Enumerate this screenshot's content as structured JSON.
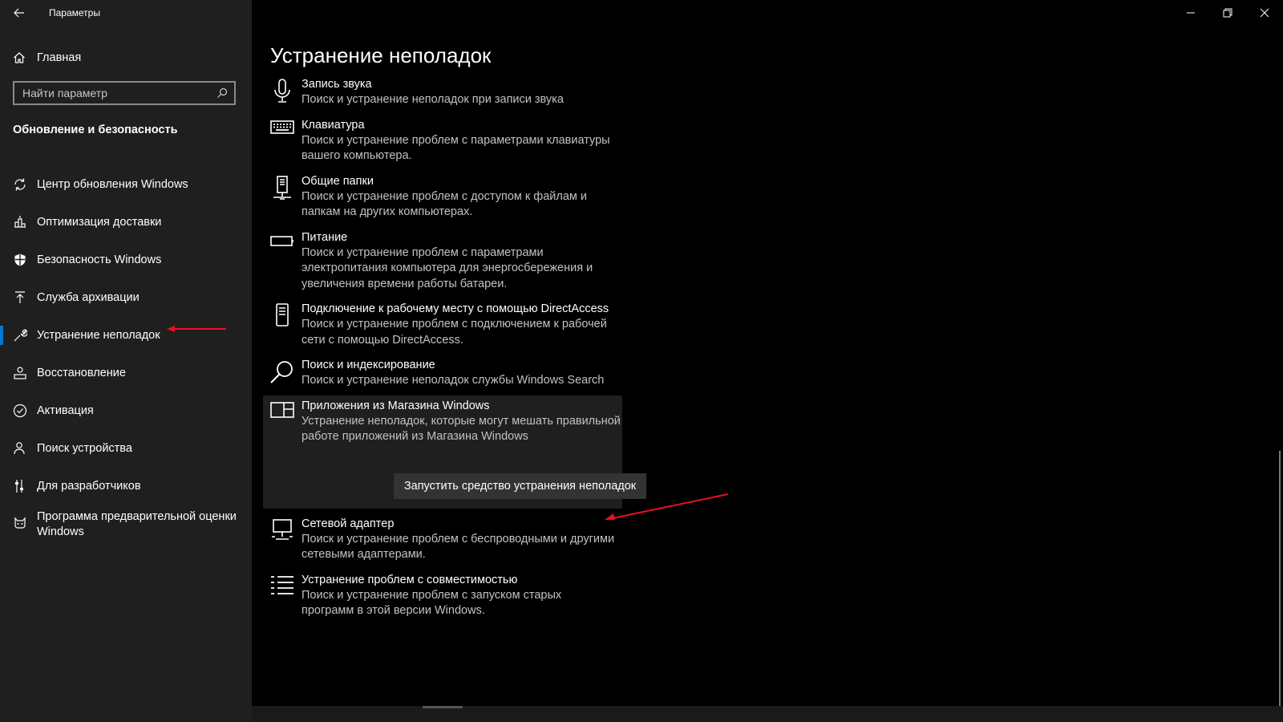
{
  "window": {
    "title": "Параметры"
  },
  "sidebar": {
    "home_label": "Главная",
    "search_placeholder": "Найти параметр",
    "section_title": "Обновление и безопасность",
    "items": [
      {
        "label": "Центр обновления Windows",
        "icon": "refresh-icon"
      },
      {
        "label": "Оптимизация доставки",
        "icon": "delivery-icon"
      },
      {
        "label": "Безопасность Windows",
        "icon": "shield-icon"
      },
      {
        "label": "Служба архивации",
        "icon": "backup-arrow-icon"
      },
      {
        "label": "Устранение неполадок",
        "icon": "wrench-icon",
        "active": true
      },
      {
        "label": "Восстановление",
        "icon": "recovery-icon"
      },
      {
        "label": "Активация",
        "icon": "check-circle-icon"
      },
      {
        "label": "Поиск устройства",
        "icon": "person-location-icon"
      },
      {
        "label": "Для разработчиков",
        "icon": "developer-sliders-icon"
      },
      {
        "label": "Программа предварительной оценки Windows",
        "icon": "insider-cat-icon"
      }
    ]
  },
  "main": {
    "title": "Устранение неполадок",
    "troubleshooters": [
      {
        "name": "Запись звука",
        "desc": "Поиск и устранение неполадок при записи звука",
        "icon": "microphone-icon"
      },
      {
        "name": "Клавиатура",
        "desc": "Поиск и устранение проблем с параметрами клавиатуры вашего компьютера.",
        "icon": "keyboard-icon"
      },
      {
        "name": "Общие папки",
        "desc": "Поиск и устранение проблем с доступом к файлам и папкам на других компьютерах.",
        "icon": "network-folder-icon"
      },
      {
        "name": "Питание",
        "desc": "Поиск и устранение проблем с параметрами электропитания компьютера для энергосбережения и увеличения  времени работы батареи.",
        "icon": "battery-icon"
      },
      {
        "name": "Подключение к рабочему месту с помощью DirectAccess",
        "desc": "Поиск и устранение проблем с подключением к рабочей сети с помощью DirectAccess.",
        "icon": "phone-device-icon"
      },
      {
        "name": "Поиск и индексирование",
        "desc": "Поиск и устранение неполадок службы Windows Search",
        "icon": "search-icon"
      },
      {
        "name": "Приложения из Магазина Windows",
        "desc": "Устранение неполадок, которые могут мешать правильной работе приложений из Магазина Windows",
        "icon": "store-apps-icon",
        "expanded": true
      },
      {
        "name": "Сетевой адаптер",
        "desc": "Поиск и устранение проблем с беспроводными и другими сетевыми адаптерами.",
        "icon": "network-adapter-icon"
      },
      {
        "name": "Устранение проблем с совместимостью",
        "desc": "Поиск и устранение проблем с запуском старых программ в этой версии Windows.",
        "icon": "list-icon"
      }
    ],
    "run_button_label": "Запустить средство устранения неполадок"
  },
  "colors": {
    "accent": "#0078d7",
    "annotation": "#e81123",
    "sidebar_bg": "#1f1f1f",
    "content_bg": "#000000"
  }
}
